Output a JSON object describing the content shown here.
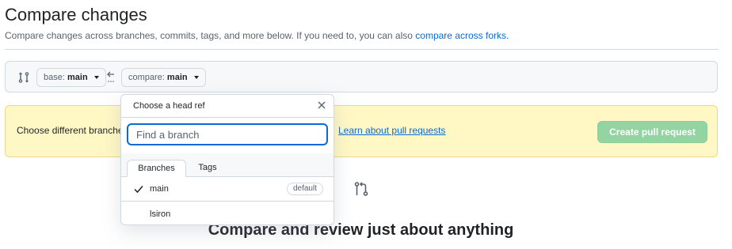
{
  "header": {
    "title": "Compare changes",
    "subtitle": "Compare changes across branches, commits, tags, and more below. If you need to, you can also ",
    "subtitle_link": "compare across forks."
  },
  "range": {
    "base_label": "base:",
    "base_value": "main",
    "compare_label": "compare:",
    "compare_value": "main"
  },
  "flash": {
    "text": "Choose different branches or forks above to discuss and review changes",
    "link": "Learn about pull requests",
    "create_button": "Create pull request"
  },
  "blankslate": {
    "heading": "Compare and review just about anything"
  },
  "dropdown": {
    "title": "Choose a head ref",
    "search_placeholder": "Find a branch",
    "tabs": [
      "Branches",
      "Tags"
    ],
    "items": [
      {
        "label": "main",
        "selected": true,
        "badge": "default"
      },
      {
        "label": "lsiron",
        "selected": false,
        "badge": ""
      }
    ]
  },
  "colors": {
    "link": "#0969da",
    "flash_bg": "#fff8c5",
    "create_button_bg": "#94d3a2",
    "focus_border": "#0969da"
  }
}
